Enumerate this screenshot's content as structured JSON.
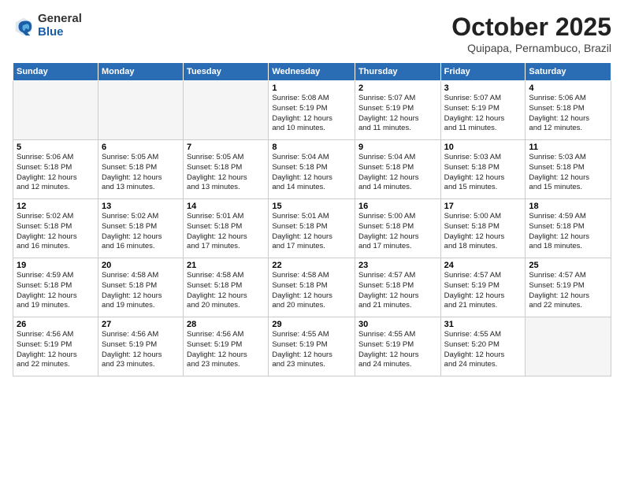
{
  "logo": {
    "general": "General",
    "blue": "Blue"
  },
  "title": "October 2025",
  "subtitle": "Quipapa, Pernambuco, Brazil",
  "days_of_week": [
    "Sunday",
    "Monday",
    "Tuesday",
    "Wednesday",
    "Thursday",
    "Friday",
    "Saturday"
  ],
  "weeks": [
    [
      {
        "day": "",
        "info": ""
      },
      {
        "day": "",
        "info": ""
      },
      {
        "day": "",
        "info": ""
      },
      {
        "day": "1",
        "info": "Sunrise: 5:08 AM\nSunset: 5:19 PM\nDaylight: 12 hours\nand 10 minutes."
      },
      {
        "day": "2",
        "info": "Sunrise: 5:07 AM\nSunset: 5:19 PM\nDaylight: 12 hours\nand 11 minutes."
      },
      {
        "day": "3",
        "info": "Sunrise: 5:07 AM\nSunset: 5:19 PM\nDaylight: 12 hours\nand 11 minutes."
      },
      {
        "day": "4",
        "info": "Sunrise: 5:06 AM\nSunset: 5:18 PM\nDaylight: 12 hours\nand 12 minutes."
      }
    ],
    [
      {
        "day": "5",
        "info": "Sunrise: 5:06 AM\nSunset: 5:18 PM\nDaylight: 12 hours\nand 12 minutes."
      },
      {
        "day": "6",
        "info": "Sunrise: 5:05 AM\nSunset: 5:18 PM\nDaylight: 12 hours\nand 13 minutes."
      },
      {
        "day": "7",
        "info": "Sunrise: 5:05 AM\nSunset: 5:18 PM\nDaylight: 12 hours\nand 13 minutes."
      },
      {
        "day": "8",
        "info": "Sunrise: 5:04 AM\nSunset: 5:18 PM\nDaylight: 12 hours\nand 14 minutes."
      },
      {
        "day": "9",
        "info": "Sunrise: 5:04 AM\nSunset: 5:18 PM\nDaylight: 12 hours\nand 14 minutes."
      },
      {
        "day": "10",
        "info": "Sunrise: 5:03 AM\nSunset: 5:18 PM\nDaylight: 12 hours\nand 15 minutes."
      },
      {
        "day": "11",
        "info": "Sunrise: 5:03 AM\nSunset: 5:18 PM\nDaylight: 12 hours\nand 15 minutes."
      }
    ],
    [
      {
        "day": "12",
        "info": "Sunrise: 5:02 AM\nSunset: 5:18 PM\nDaylight: 12 hours\nand 16 minutes."
      },
      {
        "day": "13",
        "info": "Sunrise: 5:02 AM\nSunset: 5:18 PM\nDaylight: 12 hours\nand 16 minutes."
      },
      {
        "day": "14",
        "info": "Sunrise: 5:01 AM\nSunset: 5:18 PM\nDaylight: 12 hours\nand 17 minutes."
      },
      {
        "day": "15",
        "info": "Sunrise: 5:01 AM\nSunset: 5:18 PM\nDaylight: 12 hours\nand 17 minutes."
      },
      {
        "day": "16",
        "info": "Sunrise: 5:00 AM\nSunset: 5:18 PM\nDaylight: 12 hours\nand 17 minutes."
      },
      {
        "day": "17",
        "info": "Sunrise: 5:00 AM\nSunset: 5:18 PM\nDaylight: 12 hours\nand 18 minutes."
      },
      {
        "day": "18",
        "info": "Sunrise: 4:59 AM\nSunset: 5:18 PM\nDaylight: 12 hours\nand 18 minutes."
      }
    ],
    [
      {
        "day": "19",
        "info": "Sunrise: 4:59 AM\nSunset: 5:18 PM\nDaylight: 12 hours\nand 19 minutes."
      },
      {
        "day": "20",
        "info": "Sunrise: 4:58 AM\nSunset: 5:18 PM\nDaylight: 12 hours\nand 19 minutes."
      },
      {
        "day": "21",
        "info": "Sunrise: 4:58 AM\nSunset: 5:18 PM\nDaylight: 12 hours\nand 20 minutes."
      },
      {
        "day": "22",
        "info": "Sunrise: 4:58 AM\nSunset: 5:18 PM\nDaylight: 12 hours\nand 20 minutes."
      },
      {
        "day": "23",
        "info": "Sunrise: 4:57 AM\nSunset: 5:18 PM\nDaylight: 12 hours\nand 21 minutes."
      },
      {
        "day": "24",
        "info": "Sunrise: 4:57 AM\nSunset: 5:19 PM\nDaylight: 12 hours\nand 21 minutes."
      },
      {
        "day": "25",
        "info": "Sunrise: 4:57 AM\nSunset: 5:19 PM\nDaylight: 12 hours\nand 22 minutes."
      }
    ],
    [
      {
        "day": "26",
        "info": "Sunrise: 4:56 AM\nSunset: 5:19 PM\nDaylight: 12 hours\nand 22 minutes."
      },
      {
        "day": "27",
        "info": "Sunrise: 4:56 AM\nSunset: 5:19 PM\nDaylight: 12 hours\nand 23 minutes."
      },
      {
        "day": "28",
        "info": "Sunrise: 4:56 AM\nSunset: 5:19 PM\nDaylight: 12 hours\nand 23 minutes."
      },
      {
        "day": "29",
        "info": "Sunrise: 4:55 AM\nSunset: 5:19 PM\nDaylight: 12 hours\nand 23 minutes."
      },
      {
        "day": "30",
        "info": "Sunrise: 4:55 AM\nSunset: 5:19 PM\nDaylight: 12 hours\nand 24 minutes."
      },
      {
        "day": "31",
        "info": "Sunrise: 4:55 AM\nSunset: 5:20 PM\nDaylight: 12 hours\nand 24 minutes."
      },
      {
        "day": "",
        "info": ""
      }
    ]
  ]
}
